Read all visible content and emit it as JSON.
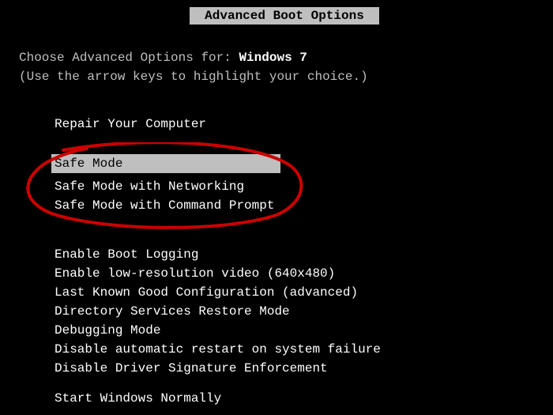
{
  "title": "Advanced Boot Options",
  "prompt": {
    "line1_prefix": "Choose Advanced Options for: ",
    "os": "Windows 7",
    "line2": "(Use the arrow keys to highlight your choice.)"
  },
  "menu": {
    "group1": [
      "Repair Your Computer"
    ],
    "group2": [
      "Safe Mode",
      "Safe Mode with Networking",
      "Safe Mode with Command Prompt"
    ],
    "group3": [
      "Enable Boot Logging",
      "Enable low-resolution video (640x480)",
      "Last Known Good Configuration (advanced)",
      "Directory Services Restore Mode",
      "Debugging Mode",
      "Disable automatic restart on system failure",
      "Disable Driver Signature Enforcement"
    ],
    "group4": [
      "Start Windows Normally"
    ]
  },
  "selected_item": "Safe Mode"
}
